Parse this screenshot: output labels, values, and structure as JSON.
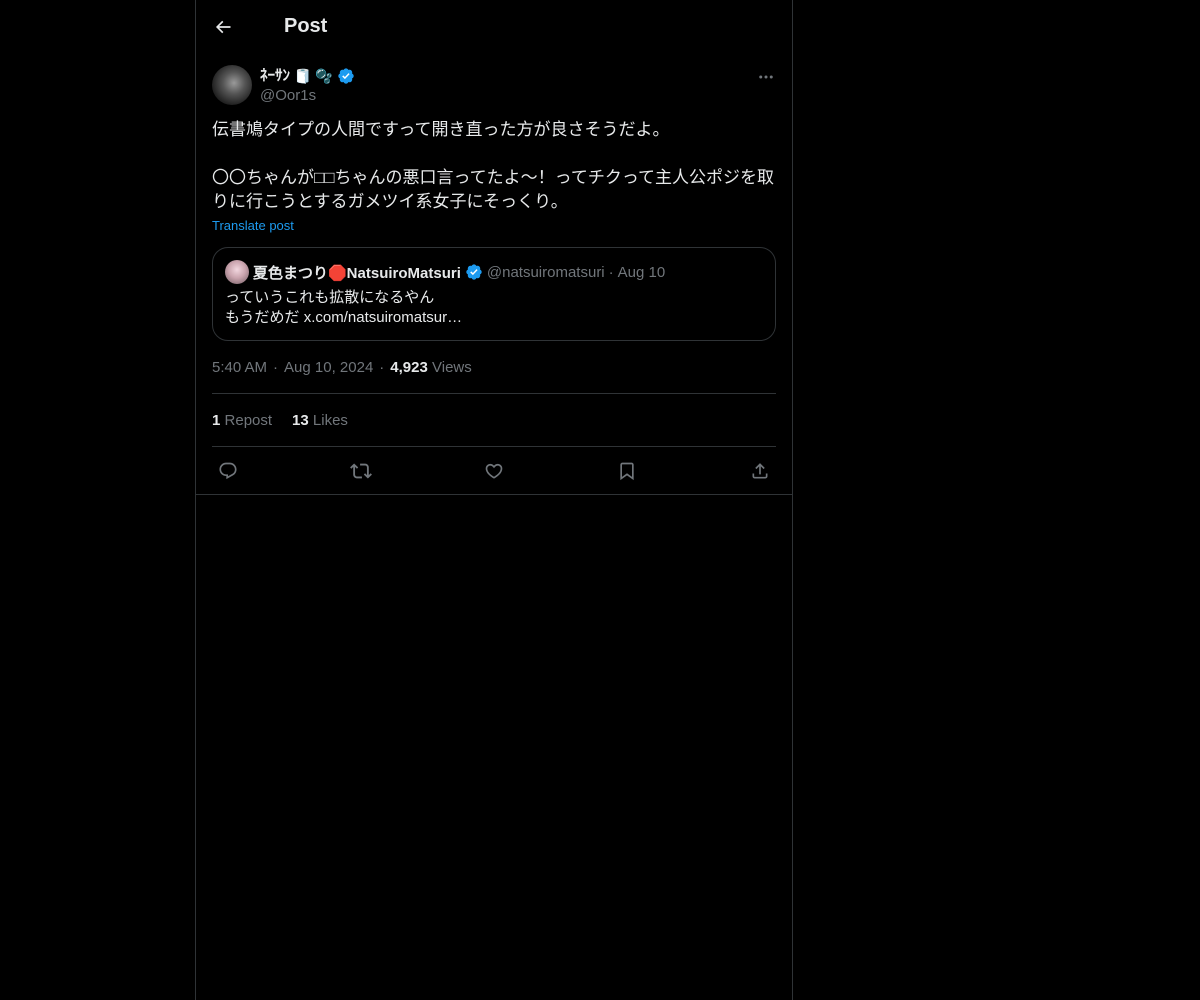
{
  "header": {
    "title": "Post"
  },
  "author": {
    "display_name": "ﾈｰｻﾝ",
    "emojis": "🧻 🫧",
    "handle": "@Oor1s"
  },
  "post": {
    "text": "伝書鳩タイプの人間ですって開き直った方が良さそうだよ。\n\n〇〇ちゃんが□□ちゃんの悪口言ってたよ〜！ってチクって主人公ポジを取りに行こうとするガメツイ系女子にそっくり。",
    "translate_label": "Translate post"
  },
  "quote": {
    "display_name": "夏色まつり🛑NatsuiroMatsuri",
    "handle": "@natsuiromatsuri",
    "separator": "·",
    "date": "Aug 10",
    "text": "っていうこれも拡散になるやん\nもうだめだ x.com/natsuiromatsur…"
  },
  "meta": {
    "time": "5:40 AM",
    "dot1": "·",
    "date": "Aug 10, 2024",
    "dot2": "·",
    "views_count": "4,923",
    "views_label": "Views"
  },
  "stats": {
    "reposts_count": "1",
    "reposts_label": "Repost",
    "likes_count": "13",
    "likes_label": "Likes"
  },
  "colors": {
    "background": "#000000",
    "text_primary": "#e7e9ea",
    "text_secondary": "#71767b",
    "accent": "#1d9bf0",
    "border": "#2f3336"
  },
  "icons": [
    "back-arrow-icon",
    "verified-icon",
    "more-icon",
    "reply-icon",
    "repost-icon",
    "like-icon",
    "bookmark-icon",
    "share-icon"
  ]
}
